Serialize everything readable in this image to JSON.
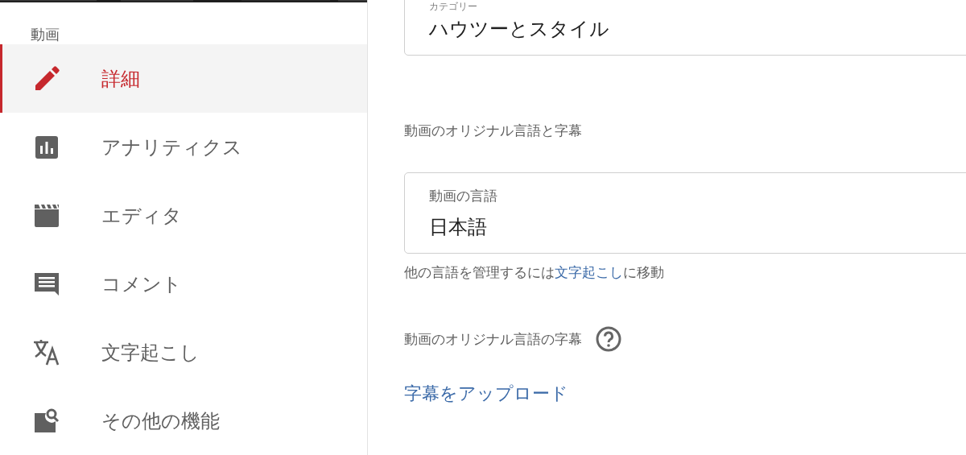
{
  "sidebar": {
    "title": "動画",
    "items": [
      {
        "label": "詳細",
        "kind": "pencil",
        "selected": true
      },
      {
        "label": "アナリティクス",
        "kind": "analytics",
        "selected": false
      },
      {
        "label": "エディタ",
        "kind": "clapper",
        "selected": false
      },
      {
        "label": "コメント",
        "kind": "comment",
        "selected": false
      },
      {
        "label": "文字起こし",
        "kind": "translate",
        "selected": false
      },
      {
        "label": "その他の機能",
        "kind": "search",
        "selected": false
      }
    ]
  },
  "category_field": {
    "label": "カテゴリー",
    "value": "ハウツーとスタイル"
  },
  "language_section": {
    "heading": "動画のオリジナル言語と字幕",
    "language_field": {
      "label": "動画の言語",
      "value": "日本語"
    },
    "helper": {
      "prefix": "他の言語を管理するには",
      "link": "文字起こし",
      "suffix": "に移動"
    },
    "subtitles_heading": "動画のオリジナル言語の字幕",
    "upload_link": "字幕をアップロード"
  }
}
